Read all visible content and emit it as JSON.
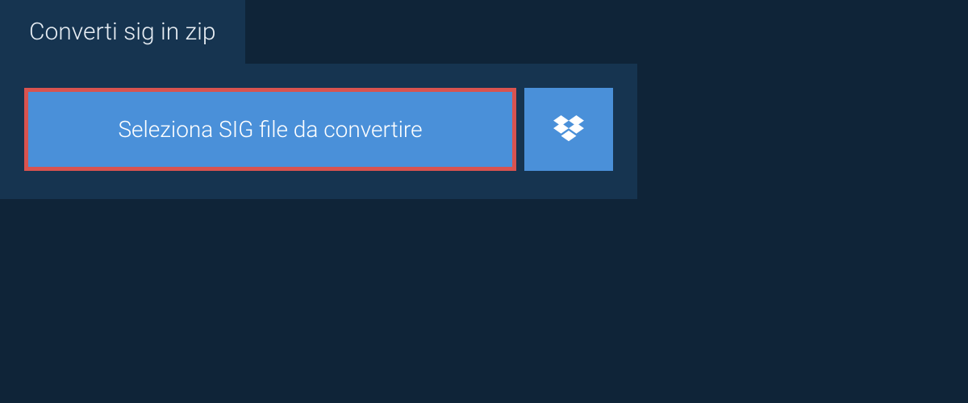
{
  "tab": {
    "title": "Converti sig in zip"
  },
  "actions": {
    "select_file_label": "Seleziona SIG file da convertire"
  },
  "colors": {
    "background": "#0f2438",
    "panel": "#163450",
    "button": "#4a90d9",
    "highlight_border": "#d9534f",
    "text_light": "#e8eef4",
    "text_white": "#ffffff"
  }
}
